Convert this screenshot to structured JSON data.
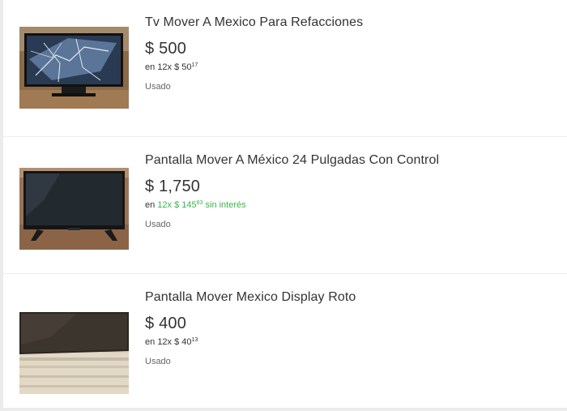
{
  "listings": [
    {
      "title": "Tv Mover A Mexico Para Refacciones",
      "price": "$ 500",
      "installments_prefix": "en",
      "installments_text": "12x $ 50",
      "installments_cents": "17",
      "installments_suffix": "",
      "condition": "Usado",
      "thumbnail": "broken-tv-photo"
    },
    {
      "title": "Pantalla Mover A México 24 Pulgadas Con Control",
      "price": "$ 1,750",
      "installments_prefix": "en",
      "installments_text": "12x $ 145",
      "installments_cents": "83",
      "installments_suffix": "sin interés",
      "condition": "Usado",
      "thumbnail": "tv-on-stand-photo"
    },
    {
      "title": "Pantalla Mover Mexico Display Roto",
      "price": "$ 400",
      "installments_prefix": "en",
      "installments_text": "12x $ 40",
      "installments_cents": "13",
      "installments_suffix": "",
      "condition": "Usado",
      "thumbnail": "tv-on-rug-photo"
    }
  ],
  "colors": {
    "text": "#333333",
    "secondary_text": "#666666",
    "interest_free_green": "#39b54a",
    "background": "#ebebeb",
    "card": "#ffffff"
  }
}
